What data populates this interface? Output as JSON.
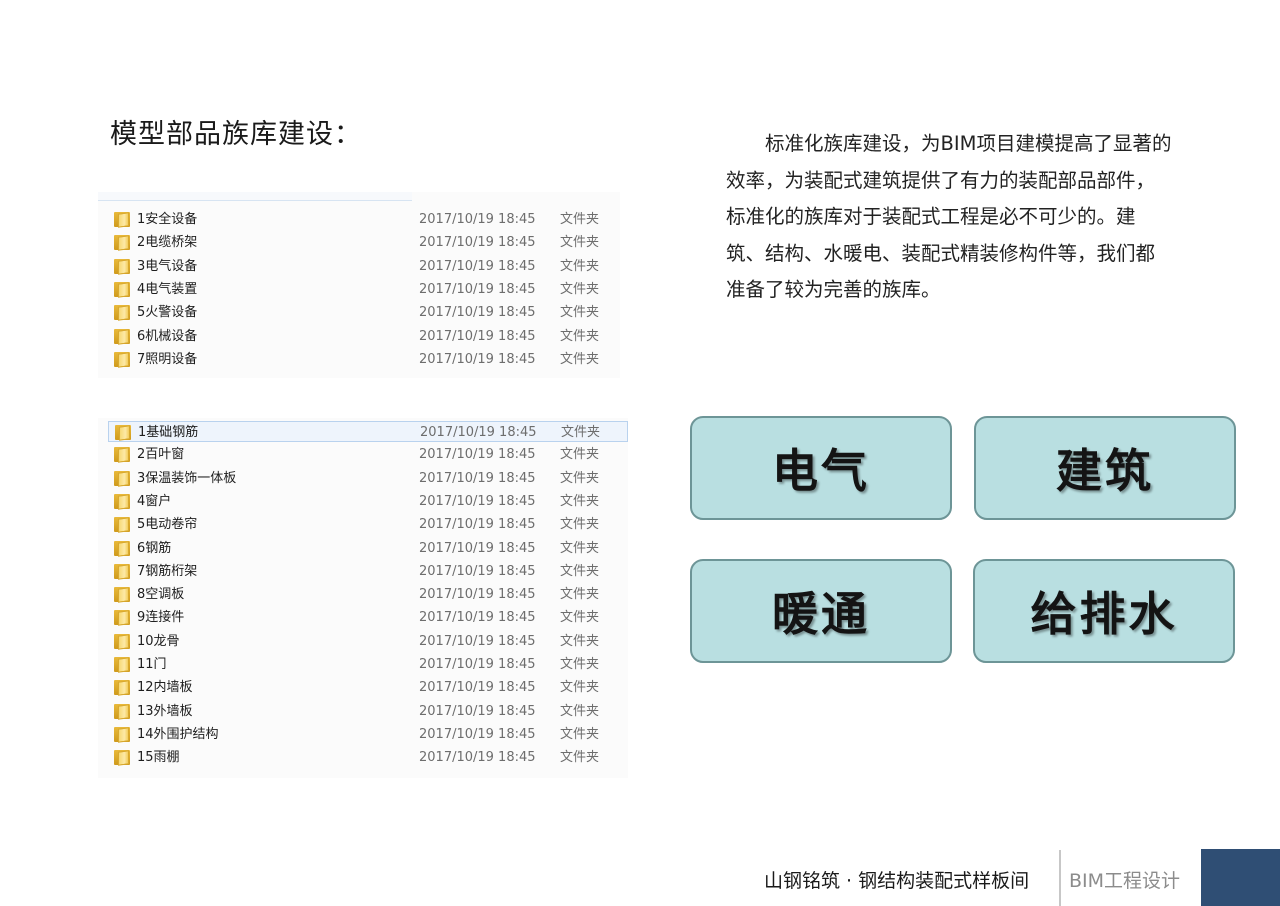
{
  "title": "模型部品族库建设：",
  "list1": [
    {
      "name": "1安全设备",
      "date": "2017/10/19 18:45",
      "type": "文件夹"
    },
    {
      "name": "2电缆桥架",
      "date": "2017/10/19 18:45",
      "type": "文件夹"
    },
    {
      "name": "3电气设备",
      "date": "2017/10/19 18:45",
      "type": "文件夹"
    },
    {
      "name": "4电气装置",
      "date": "2017/10/19 18:45",
      "type": "文件夹"
    },
    {
      "name": "5火警设备",
      "date": "2017/10/19 18:45",
      "type": "文件夹"
    },
    {
      "name": "6机械设备",
      "date": "2017/10/19 18:45",
      "type": "文件夹"
    },
    {
      "name": "7照明设备",
      "date": "2017/10/19 18:45",
      "type": "文件夹"
    }
  ],
  "list2": [
    {
      "name": "1基础钢筋",
      "date": "2017/10/19 18:45",
      "type": "文件夹",
      "selected": true
    },
    {
      "name": "2百叶窗",
      "date": "2017/10/19 18:45",
      "type": "文件夹"
    },
    {
      "name": "3保温装饰一体板",
      "date": "2017/10/19 18:45",
      "type": "文件夹"
    },
    {
      "name": "4窗户",
      "date": "2017/10/19 18:45",
      "type": "文件夹"
    },
    {
      "name": "5电动卷帘",
      "date": "2017/10/19 18:45",
      "type": "文件夹"
    },
    {
      "name": "6钢筋",
      "date": "2017/10/19 18:45",
      "type": "文件夹"
    },
    {
      "name": "7钢筋桁架",
      "date": "2017/10/19 18:45",
      "type": "文件夹"
    },
    {
      "name": "8空调板",
      "date": "2017/10/19 18:45",
      "type": "文件夹"
    },
    {
      "name": "9连接件",
      "date": "2017/10/19 18:45",
      "type": "文件夹"
    },
    {
      "name": "10龙骨",
      "date": "2017/10/19 18:45",
      "type": "文件夹"
    },
    {
      "name": "11门",
      "date": "2017/10/19 18:45",
      "type": "文件夹"
    },
    {
      "name": "12内墙板",
      "date": "2017/10/19 18:45",
      "type": "文件夹"
    },
    {
      "name": "13外墙板",
      "date": "2017/10/19 18:45",
      "type": "文件夹"
    },
    {
      "name": "14外围护结构",
      "date": "2017/10/19 18:45",
      "type": "文件夹"
    },
    {
      "name": "15雨棚",
      "date": "2017/10/19 18:45",
      "type": "文件夹"
    }
  ],
  "description": "标准化族库建设，为BIM项目建模提高了显著的效率，为装配式建筑提供了有力的装配部品部件，标准化的族库对于装配式工程是必不可少的。建筑、结构、水暖电、装配式精装修构件等，我们都准备了较为完善的族库。",
  "categories": [
    "电气",
    "建筑",
    "暖通",
    "给排水"
  ],
  "footer": {
    "brand": "山钢铭筑 · 钢结构装配式样板间",
    "tag": "BIM工程设计"
  },
  "colors": {
    "category_fill": "#b9dfe1",
    "category_border": "#6d9597",
    "footer_block": "#2f4e74",
    "folder_icon": "#f2cd5c"
  },
  "icons": {
    "folder": "folder-icon"
  }
}
